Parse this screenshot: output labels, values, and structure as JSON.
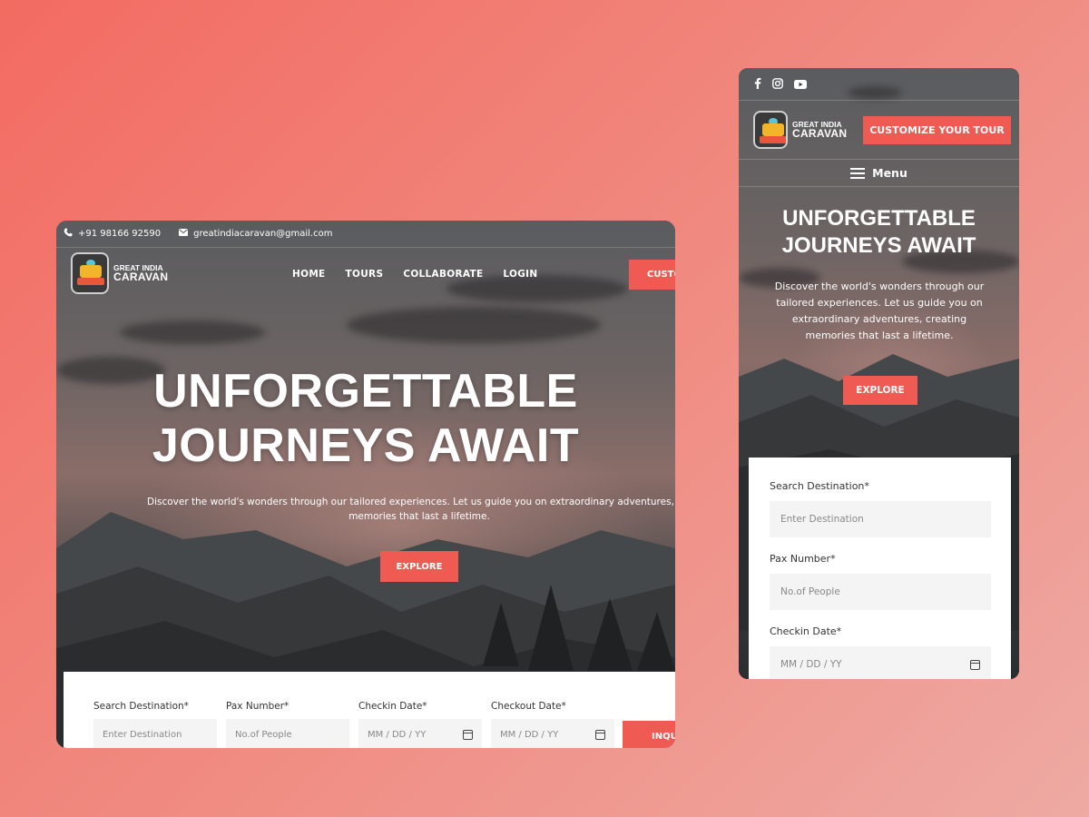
{
  "brand": {
    "line1": "GREAT INDIA",
    "line2": "CARAVAN"
  },
  "desktop": {
    "topbar": {
      "phone": "+91 98166 92590",
      "email": "greatindiacaravan@gmail.com"
    },
    "nav": {
      "items": [
        "HOME",
        "TOURS",
        "COLLABORATE",
        "LOGIN"
      ],
      "cta_label": "CUSTO"
    },
    "hero": {
      "title_line1": "UNFORGETTABLE",
      "title_line2": "JOURNEYS AWAIT",
      "subtitle_line1": "Discover the world's wonders through our tailored experiences. Let us guide you on extraordinary adventures, creatin",
      "subtitle_line2": "memories that last a lifetime.",
      "explore_label": "EXPLORE"
    },
    "form": {
      "fields": [
        {
          "label": "Search Destination*",
          "placeholder": "Enter Destination"
        },
        {
          "label": "Pax Number*",
          "placeholder": "No.of People"
        },
        {
          "label": "Checkin Date*",
          "placeholder": "MM / DD / YY"
        },
        {
          "label": "Checkout Date*",
          "placeholder": "MM / DD / YY"
        }
      ],
      "submit_label": "INQU"
    }
  },
  "mobile": {
    "social": [
      "facebook-icon",
      "instagram-icon",
      "youtube-icon"
    ],
    "cta_label": "CUSTOMIZE YOUR TOUR",
    "menu_label": "Menu",
    "hero": {
      "title_line1": "UNFORGETTABLE",
      "title_line2": "JOURNEYS AWAIT",
      "subtitle": "Discover the world's wonders through our tailored experiences. Let us guide you on extraordinary adventures, creating memories that last a lifetime.",
      "explore_label": "EXPLORE"
    },
    "form": {
      "fields": [
        {
          "label": "Search Destination*",
          "placeholder": "Enter Destination"
        },
        {
          "label": "Pax Number*",
          "placeholder": "No.of People"
        },
        {
          "label": "Checkin Date*",
          "placeholder": "MM / DD / YY"
        }
      ]
    }
  },
  "colors": {
    "accent": "#ef5a52",
    "background_start": "#f36b62",
    "background_end": "#eeaaa3"
  }
}
